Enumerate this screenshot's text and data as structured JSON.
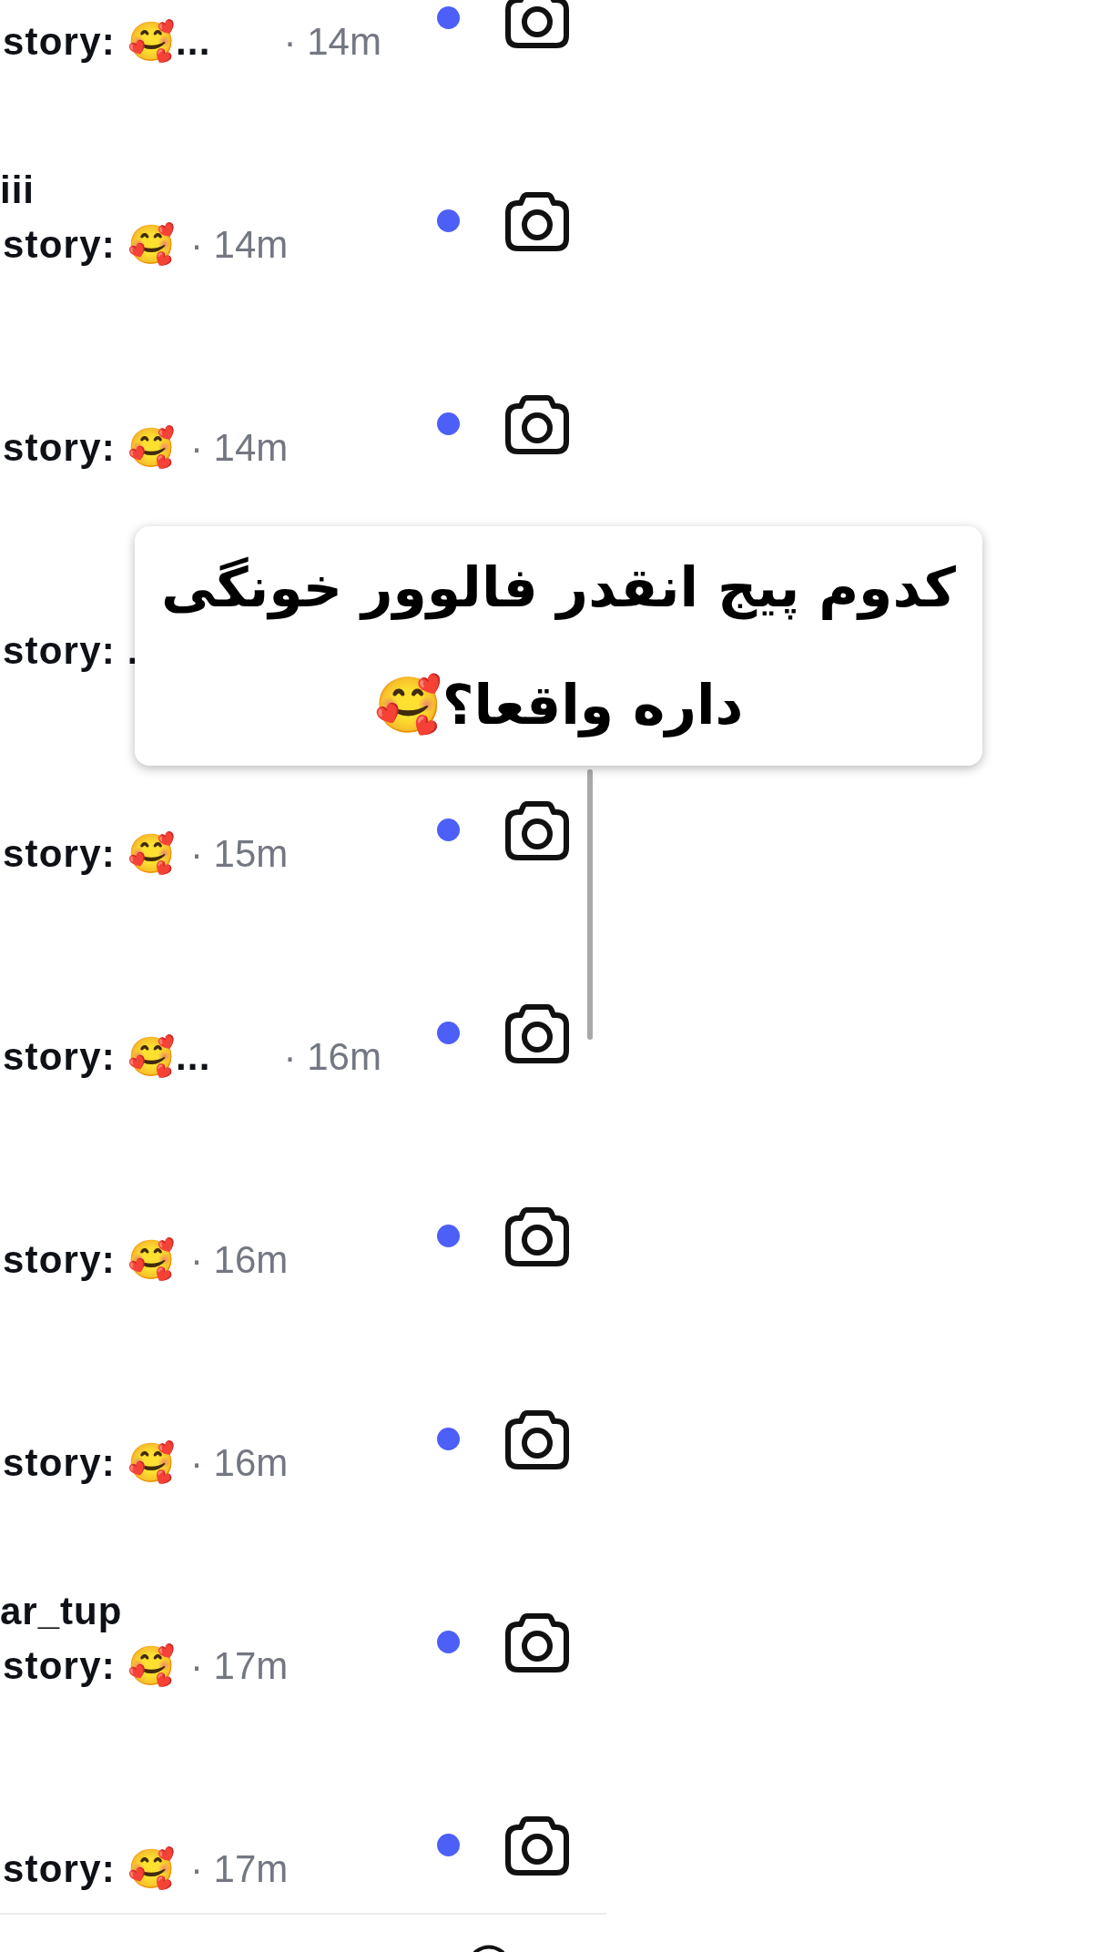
{
  "rows": [
    {
      "kind": "truncated",
      "preview": "story: 🥰...",
      "time": "· 14m",
      "unread": true
    },
    {
      "kind": "plain",
      "username": "iii",
      "preview": "story: 🥰",
      "time": "· 14m",
      "unread": true
    },
    {
      "kind": "plain",
      "preview": "story: 🥰",
      "time": "· 14m",
      "unread": true
    },
    {
      "kind": "covered",
      "preview": "story: ."
    },
    {
      "kind": "plain",
      "preview": "story: 🥰",
      "time": "· 15m",
      "unread": true
    },
    {
      "kind": "truncated",
      "preview": "story: 🥰...",
      "time": "· 16m",
      "unread": true
    },
    {
      "kind": "plain",
      "preview": "story: 🥰",
      "time": "· 16m",
      "unread": true
    },
    {
      "kind": "plain",
      "preview": "story: 🥰",
      "time": "· 16m",
      "unread": true
    },
    {
      "kind": "plain",
      "username": "ar_tup",
      "preview": "story: 🥰",
      "time": "· 17m",
      "unread": true
    },
    {
      "kind": "plain",
      "preview": "story: 🥰",
      "time": "· 17m",
      "unread": true
    }
  ],
  "caption": {
    "lines": [
      "کدوم پیج انقدر فالوور خونگی",
      "داره واقعا؟🥰"
    ]
  }
}
